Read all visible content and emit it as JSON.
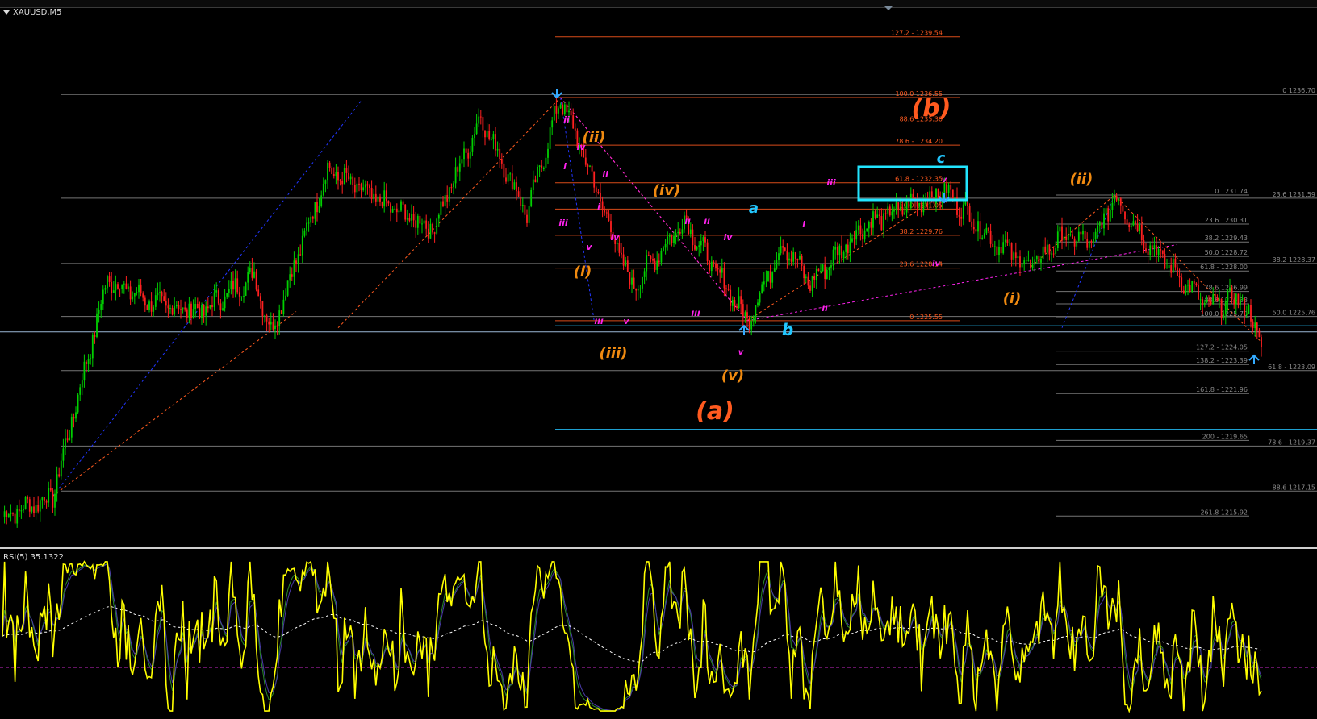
{
  "chart_title": "XAUUSD,M5",
  "chart_data": {
    "type": "candlestick",
    "symbol": "XAUUSD",
    "timeframe": "M5",
    "ylim": [
      1214.5,
      1240.8
    ],
    "colors": {
      "up": "#00d000",
      "down": "#ff2020",
      "background": "#000000",
      "fib_orange": "#ff5a1f",
      "fib_gray": "#8a8a8a",
      "cyan": "#33ccff",
      "wave_orange": "#f08a10",
      "wave_magenta": "#ff22ee",
      "rsi": "#ffff00"
    },
    "pivots": [
      {
        "i": 0,
        "p": 1215.9
      },
      {
        "i": 24,
        "p": 1216.9
      },
      {
        "i": 50,
        "p": 1227.6
      },
      {
        "i": 72,
        "p": 1226.4
      },
      {
        "i": 95,
        "p": 1226.0
      },
      {
        "i": 120,
        "p": 1227.8
      },
      {
        "i": 128,
        "p": 1225.0
      },
      {
        "i": 155,
        "p": 1233.0
      },
      {
        "i": 180,
        "p": 1231.4
      },
      {
        "i": 205,
        "p": 1230.1
      },
      {
        "i": 228,
        "p": 1235.6
      },
      {
        "i": 250,
        "p": 1230.8
      },
      {
        "i": 266,
        "p": 1236.55
      },
      {
        "i": 280,
        "p": 1232.9
      },
      {
        "i": 300,
        "p": 1227.2
      },
      {
        "i": 325,
        "p": 1230.5
      },
      {
        "i": 355,
        "p": 1225.55
      },
      {
        "i": 372,
        "p": 1229.4
      },
      {
        "i": 385,
        "p": 1227.4
      },
      {
        "i": 410,
        "p": 1230.2
      },
      {
        "i": 440,
        "p": 1231.6
      },
      {
        "i": 450,
        "p": 1231.9
      },
      {
        "i": 470,
        "p": 1229.7
      },
      {
        "i": 490,
        "p": 1228.2
      },
      {
        "i": 505,
        "p": 1229.7
      },
      {
        "i": 520,
        "p": 1229.4
      },
      {
        "i": 530,
        "p": 1231.74
      },
      {
        "i": 545,
        "p": 1229.5
      },
      {
        "i": 560,
        "p": 1227.8
      },
      {
        "i": 575,
        "p": 1226.2
      },
      {
        "i": 590,
        "p": 1226.7
      },
      {
        "i": 600,
        "p": 1224.5
      }
    ],
    "fib_set_1": {
      "levels": [
        {
          "label": "127.2 - 1239.54",
          "price": 1239.54
        },
        {
          "label": "100.0 1236.55",
          "price": 1236.55
        },
        {
          "label": "88.6 1235.30",
          "price": 1235.3
        },
        {
          "label": "78.6 - 1234.20",
          "price": 1234.2
        },
        {
          "label": "61.8 - 1232.35",
          "price": 1232.35
        },
        {
          "label": "50.0 1231.05",
          "price": 1231.05
        },
        {
          "label": "38.2 1229.76",
          "price": 1229.76
        },
        {
          "label": "23.6 1228.14",
          "price": 1228.14
        },
        {
          "label": "0 1225.55",
          "price": 1225.55
        }
      ]
    },
    "fib_set_2": {
      "levels": [
        {
          "label": "0 1231.74",
          "price": 1231.74
        },
        {
          "label": "23.6 1230.31",
          "price": 1230.31
        },
        {
          "label": "38.2 1229.43",
          "price": 1229.43
        },
        {
          "label": "50.0 1228.72",
          "price": 1228.72
        },
        {
          "label": "61.8 - 1228.00",
          "price": 1228.0
        },
        {
          "label": "78.6 1226.99",
          "price": 1226.99
        },
        {
          "label": "88.6 1226.38",
          "price": 1226.38
        },
        {
          "label": "100.0 1225.70",
          "price": 1225.7
        },
        {
          "label": "127.2 - 1224.05",
          "price": 1224.05
        },
        {
          "label": "138.2 - 1223.39",
          "price": 1223.39
        },
        {
          "label": "161.8 - 1221.96",
          "price": 1221.96
        },
        {
          "label": "200 - 1219.65",
          "price": 1219.65
        },
        {
          "label": "261.8 1215.92",
          "price": 1215.92
        }
      ]
    },
    "fib_set_3": {
      "levels": [
        {
          "label": "0 1236.70",
          "price": 1236.7
        },
        {
          "label": "23.6 1231.59",
          "price": 1231.59
        },
        {
          "label": "38.2 1228.37",
          "price": 1228.37
        },
        {
          "label": "50.0 1225.76",
          "price": 1225.76
        },
        {
          "label": "61.8 - 1223.09",
          "price": 1223.09
        },
        {
          "label": "78.6 - 1219.37",
          "price": 1219.37
        },
        {
          "label": "88.6 1217.15",
          "price": 1217.15
        }
      ]
    },
    "wave_labels": [
      {
        "text": "(b)",
        "color": "orange-red",
        "size": "large"
      },
      {
        "text": "(a)",
        "color": "orange-red",
        "size": "large"
      },
      {
        "text": "(ii)",
        "color": "orange"
      },
      {
        "text": "(iv)",
        "color": "orange"
      },
      {
        "text": "(i)",
        "color": "orange"
      },
      {
        "text": "(iii)",
        "color": "orange"
      },
      {
        "text": "(v)",
        "color": "orange"
      },
      {
        "text": "(ii)",
        "color": "orange"
      },
      {
        "text": "(i)",
        "color": "orange"
      },
      {
        "text": "a",
        "color": "cyan"
      },
      {
        "text": "b",
        "color": "cyan"
      },
      {
        "text": "c",
        "color": "cyan"
      },
      {
        "text": "ii",
        "color": "magenta"
      },
      {
        "text": "iv",
        "color": "magenta"
      },
      {
        "text": "i",
        "color": "magenta"
      },
      {
        "text": "ii",
        "color": "magenta"
      },
      {
        "text": "i",
        "color": "magenta"
      },
      {
        "text": "iii",
        "color": "magenta"
      },
      {
        "text": "v",
        "color": "magenta"
      },
      {
        "text": "iv",
        "color": "magenta"
      },
      {
        "text": "ii",
        "color": "magenta"
      },
      {
        "text": "iii",
        "color": "magenta"
      },
      {
        "text": "v",
        "color": "magenta"
      },
      {
        "text": "iii",
        "color": "magenta"
      },
      {
        "text": "iv",
        "color": "magenta"
      },
      {
        "text": "i",
        "color": "magenta"
      },
      {
        "text": "iii",
        "color": "magenta"
      },
      {
        "text": "ii",
        "color": "magenta"
      },
      {
        "text": "v",
        "color": "magenta"
      },
      {
        "text": "v",
        "color": "magenta"
      },
      {
        "text": "iv",
        "color": "magenta"
      },
      {
        "text": "ii",
        "color": "magenta"
      }
    ],
    "rsi": {
      "label": "RSI(5) 35.1322",
      "period": 5,
      "value": 35.1322
    }
  }
}
